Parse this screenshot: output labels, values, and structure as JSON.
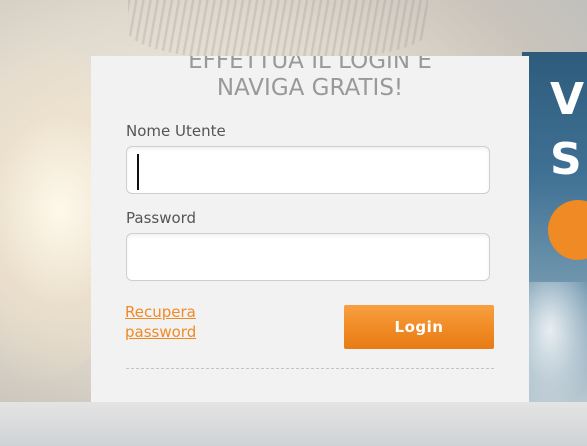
{
  "headline": {
    "line1": "EFFETTUA IL LOGIN E",
    "line2": "NAVIGA GRATIS!"
  },
  "form": {
    "username_label": "Nome Utente",
    "username_value": "",
    "password_label": "Password",
    "password_value": "",
    "recover_link": "Recupera password",
    "login_button": "Login"
  },
  "background": {
    "right_panel_letters": [
      "V",
      "S"
    ]
  },
  "colors": {
    "accent": "#f08a24",
    "card": "#f2f2f2",
    "headline": "#999999",
    "label": "#555555",
    "right_panel": "#3f7194"
  }
}
